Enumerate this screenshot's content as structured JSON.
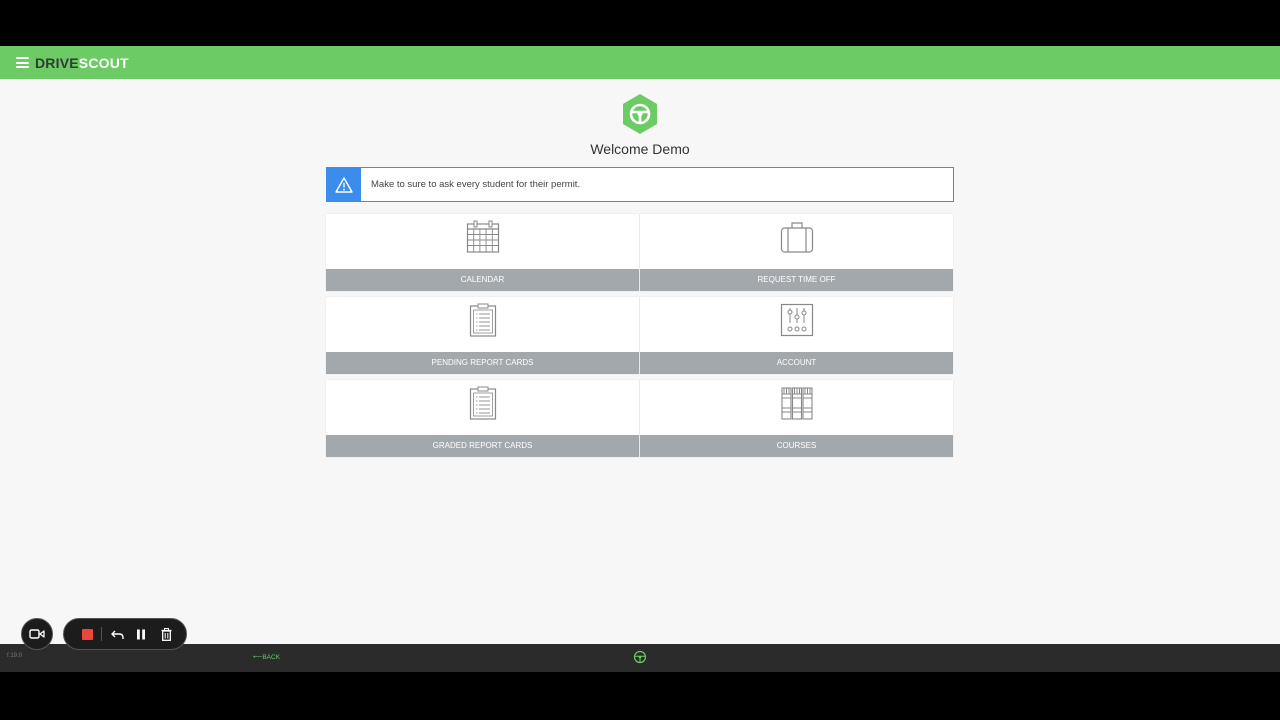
{
  "header": {
    "brand_part1": "DRIVE",
    "brand_part2": "SCOUT",
    "menu_icon": "hamburger-icon",
    "color": "#6ccb64"
  },
  "welcome": "Welcome Demo",
  "alert": {
    "icon": "warning-icon",
    "text": "Make to sure to ask every student for their permit.",
    "color": "#3b8ced"
  },
  "tiles": [
    {
      "label": "CALENDAR",
      "icon": "calendar-icon"
    },
    {
      "label": "REQUEST TIME OFF",
      "icon": "suitcase-icon"
    },
    {
      "label": "PENDING REPORT CARDS",
      "icon": "clipboard-icon"
    },
    {
      "label": "ACCOUNT",
      "icon": "sliders-icon"
    },
    {
      "label": "GRADED REPORT CARDS",
      "icon": "clipboard-icon"
    },
    {
      "label": "COURSES",
      "icon": "books-icon"
    }
  ],
  "footer": {
    "version": "f.19.0",
    "back": "BACK",
    "back_prefix": "⟵"
  },
  "recorder": {
    "camera_icon": "video-camera-icon",
    "stop_icon": "stop-icon",
    "undo_icon": "undo-icon",
    "pause_icon": "pause-icon",
    "delete_icon": "trash-icon"
  }
}
